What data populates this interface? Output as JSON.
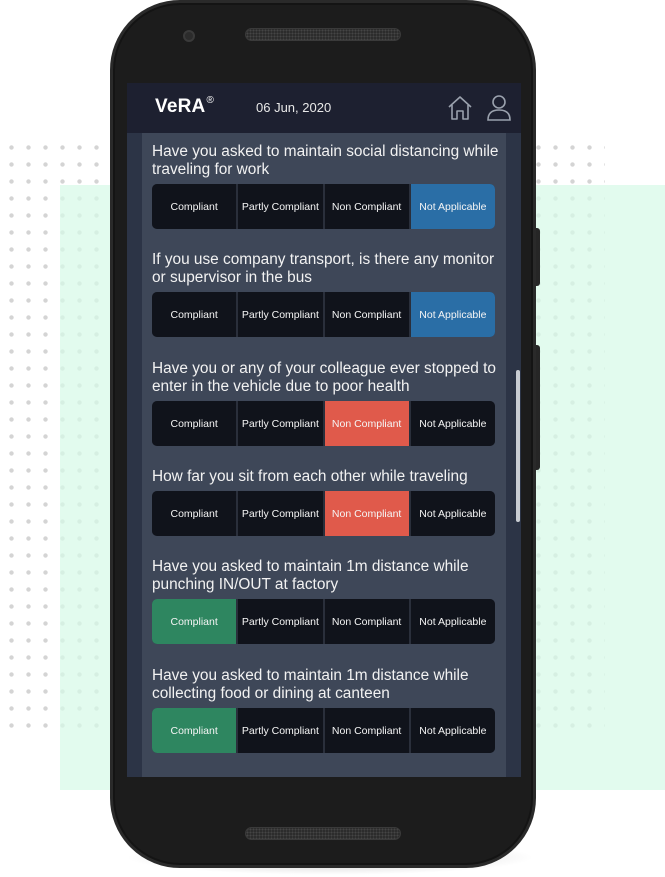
{
  "header": {
    "app_name": "VeRA",
    "registered_mark": "®",
    "date": "06 Jun, 2020",
    "icons": [
      "home-icon",
      "user-profile-icon"
    ]
  },
  "option_labels": [
    "Compliant",
    "Partly Compliant",
    "Non Compliant",
    "Not Applicable"
  ],
  "colors": {
    "compliant_selected": "#2e8660",
    "non_compliant_selected": "#e05a4b",
    "not_applicable_selected": "#2a6ea6",
    "unselected": "#10131b",
    "header_bg": "#1d2030",
    "panel_bg": "#3e4758"
  },
  "questions": [
    {
      "text": "Have you asked to maintain social distancing while traveling for work",
      "selected": "Not Applicable"
    },
    {
      "text": "If you use company transport, is there any monitor or supervisor in the bus",
      "selected": "Not Applicable"
    },
    {
      "text": "Have you or any of your colleague ever stopped to enter in the vehicle due to poor health",
      "selected": "Non Compliant"
    },
    {
      "text": "How far you sit from each other while traveling",
      "selected": "Non Compliant"
    },
    {
      "text": "Have you asked to maintain 1m distance while punching IN/OUT at factory",
      "selected": "Compliant"
    },
    {
      "text": "Have you asked to maintain 1m distance while collecting food or dining at canteen",
      "selected": "Compliant"
    }
  ]
}
